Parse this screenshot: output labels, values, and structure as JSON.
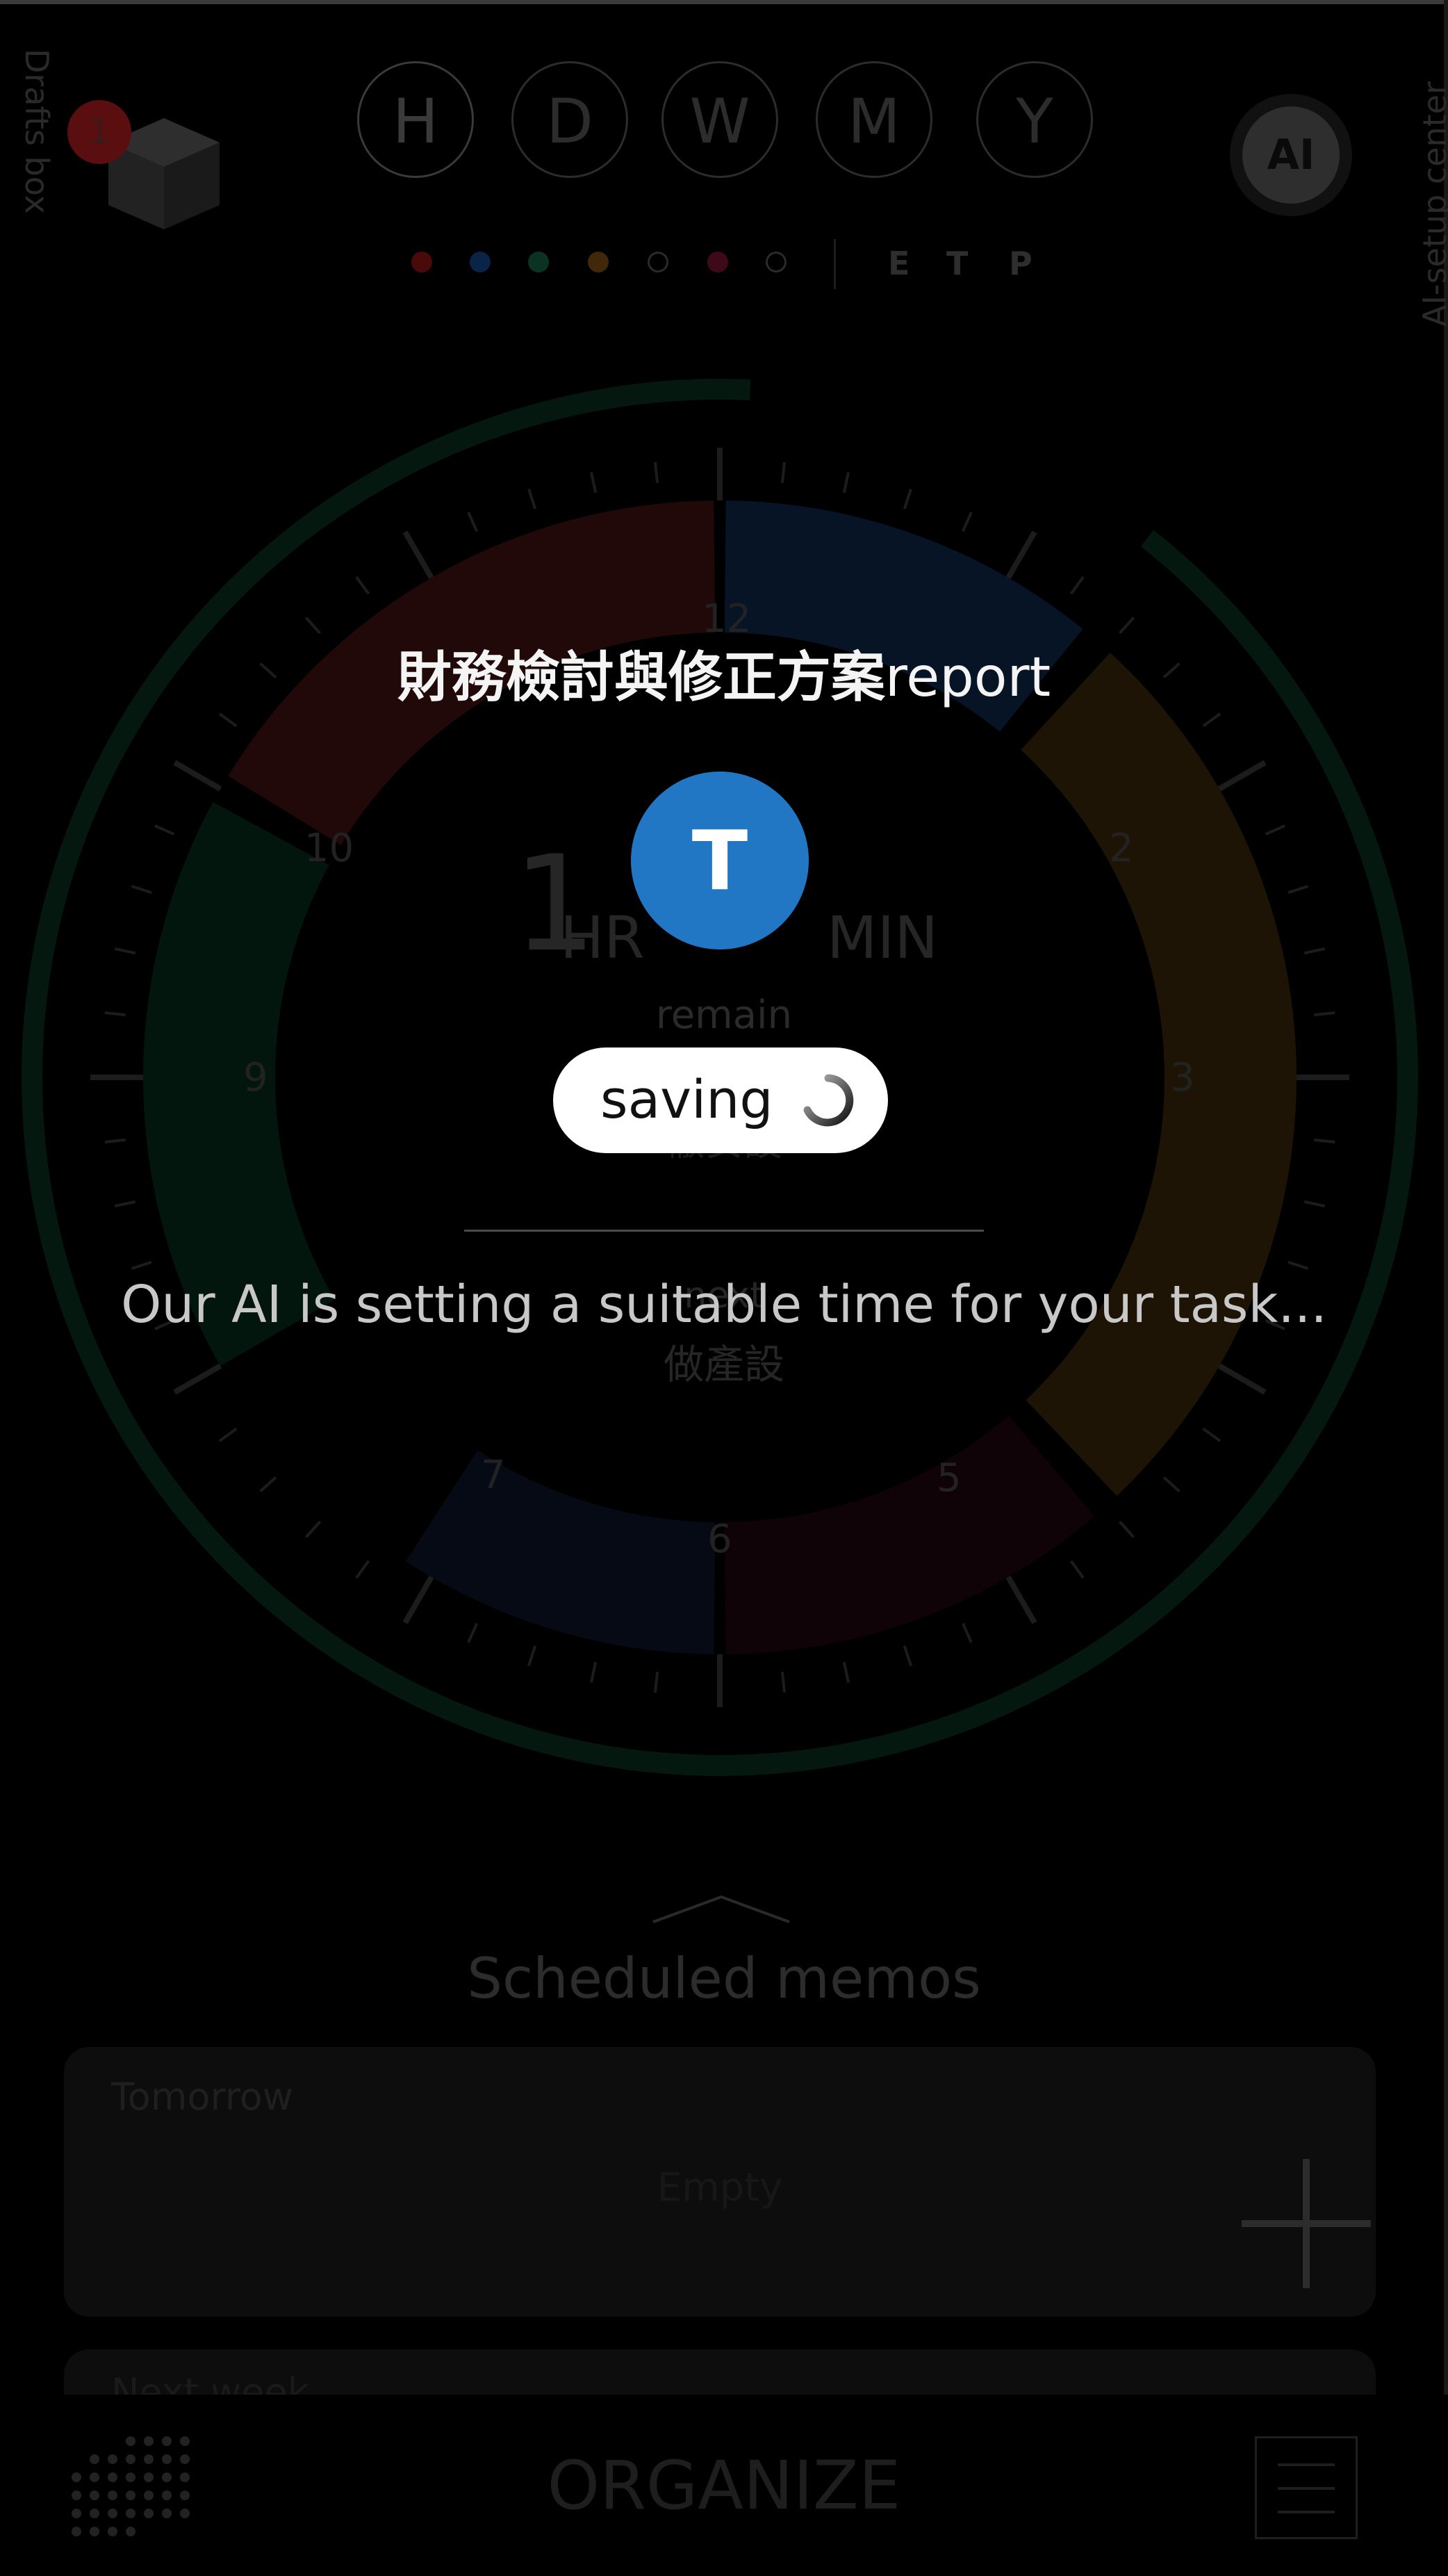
{
  "header": {
    "drafts_label": "Drafts box",
    "drafts_count": "1",
    "periods": [
      "H",
      "D",
      "W",
      "M",
      "Y"
    ],
    "active_period": "H",
    "ai_button_label": "AI",
    "ai_center_label": "AI-setup center",
    "category_colors": [
      "#5a0c0c",
      "#0c2a55",
      "#0c3a28",
      "#4a300a",
      "ring",
      "#4a0c20",
      "ring"
    ],
    "view_modes": [
      "E",
      "T",
      "P"
    ]
  },
  "clock": {
    "numbers": [
      "12",
      "2",
      "3",
      "5",
      "6",
      "7",
      "9",
      "10"
    ],
    "remaining_hr": "1",
    "hr_unit": "HR",
    "min_unit": "MIN",
    "remain_label": "remain",
    "current_task_hidden": "徹安設",
    "next_label": "next",
    "next_task": "做產設"
  },
  "schedule": {
    "title": "Scheduled memos",
    "cards": [
      {
        "day": "Tomorrow",
        "empty": "Empty"
      },
      {
        "day": "Next week",
        "empty": ""
      }
    ]
  },
  "bottom": {
    "organize_label": "ORGANIZE"
  },
  "modal": {
    "title_cjk": "財務檢討與修正方案",
    "title_latin": "report",
    "avatar_letter": "T",
    "avatar_color": "#2277c5",
    "saving_label": "saving",
    "message": "Our AI is setting a suitable time for your task..."
  }
}
